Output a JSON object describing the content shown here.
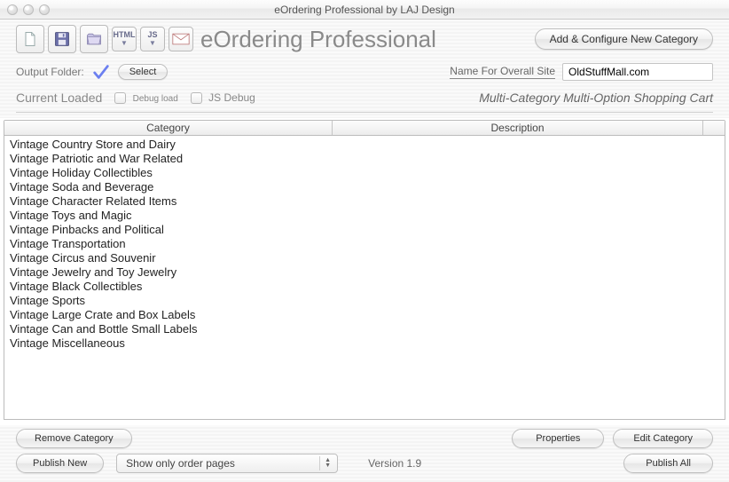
{
  "window": {
    "title": "eOrdering Professional by LAJ Design"
  },
  "header": {
    "app_title": "eOrdering Professional",
    "add_category_btn": "Add & Configure New Category"
  },
  "toolbar_icons": {
    "new": "new-icon",
    "save": "floppy-icon",
    "open": "folder-icon",
    "html": "HTML",
    "js": "JS",
    "mail": "mail-icon"
  },
  "output_row": {
    "label": "Output Folder:",
    "select_btn": "Select",
    "site_name_label": "Name For Overall Site",
    "site_name_value": "OldStuffMall.com"
  },
  "status_row": {
    "current_loaded": "Current Loaded",
    "debug_load": "Debug load",
    "js_debug": "JS Debug",
    "cart_type": "Multi-Category Multi-Option Shopping Cart"
  },
  "table": {
    "columns": {
      "category": "Category",
      "description": "Description"
    },
    "categories": [
      "Vintage Country Store and Dairy",
      "Vintage Patriotic and War Related",
      "Vintage Holiday Collectibles",
      "Vintage Soda and Beverage",
      "Vintage Character Related Items",
      "Vintage Toys and Magic",
      "Vintage Pinbacks and Political",
      "Vintage Transportation",
      "Vintage Circus and Souvenir",
      "Vintage Jewelry and Toy Jewelry",
      "Vintage Black Collectibles",
      "Vintage Sports",
      "Vintage Large Crate and Box Labels",
      "Vintage Can and Bottle Small Labels",
      "Vintage Miscellaneous"
    ]
  },
  "footer": {
    "remove_category": "Remove Category",
    "properties": "Properties",
    "edit_category": "Edit Category",
    "publish_new": "Publish New",
    "filter_selected": "Show only order pages",
    "version": "Version 1.9",
    "publish_all": "Publish All"
  }
}
